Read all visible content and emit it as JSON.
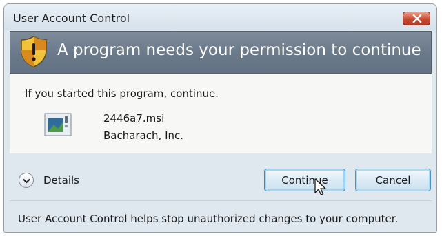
{
  "window": {
    "title": "User Account Control"
  },
  "header": {
    "message": "A program needs your permission to continue",
    "icon": "security-shield-icon"
  },
  "content": {
    "prompt": "If you started this program, continue.",
    "program": {
      "icon": "installer-package-icon",
      "name": "2446a7.msi",
      "publisher": "Bacharach, Inc."
    }
  },
  "actions": {
    "details_label": "Details",
    "continue_label": "Continue",
    "cancel_label": "Cancel"
  },
  "footer": {
    "text": "User Account Control helps stop unauthorized changes to your computer."
  },
  "colors": {
    "header_band": "#6a7989",
    "close_button": "#c9472f",
    "button_border_focus": "#3d86c0"
  }
}
